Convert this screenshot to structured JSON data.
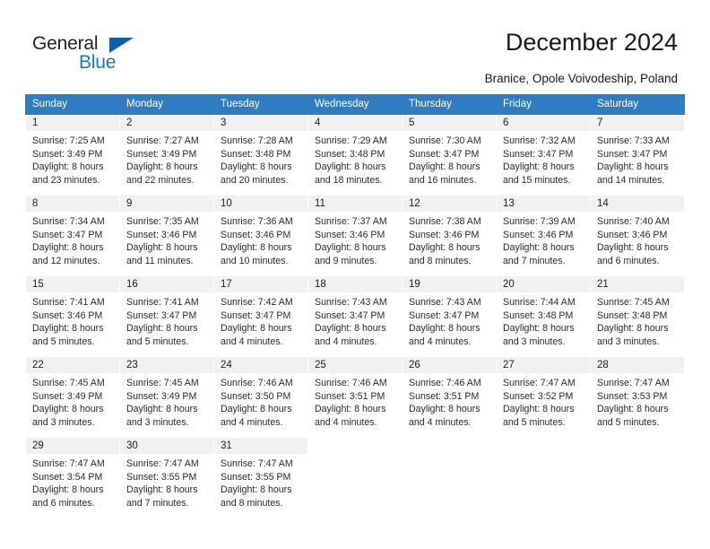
{
  "brand": {
    "name_part1": "General",
    "name_part2": "Blue",
    "triangle_icon": "blue-triangle-icon",
    "color_dark": "#222222",
    "color_blue": "#1f7ac4",
    "color_triangle": "#1060a8"
  },
  "header": {
    "title": "December 2024",
    "subtitle": "Branice, Opole Voivodeship, Poland"
  },
  "calendar": {
    "accent_color": "#2f7cc0",
    "daynum_bg": "#f1f1f1",
    "weekday_headers": [
      "Sunday",
      "Monday",
      "Tuesday",
      "Wednesday",
      "Thursday",
      "Friday",
      "Saturday"
    ],
    "weeks": [
      [
        {
          "day": "1",
          "sunrise": "Sunrise: 7:25 AM",
          "sunset": "Sunset: 3:49 PM",
          "daylight1": "Daylight: 8 hours",
          "daylight2": "and 23 minutes."
        },
        {
          "day": "2",
          "sunrise": "Sunrise: 7:27 AM",
          "sunset": "Sunset: 3:49 PM",
          "daylight1": "Daylight: 8 hours",
          "daylight2": "and 22 minutes."
        },
        {
          "day": "3",
          "sunrise": "Sunrise: 7:28 AM",
          "sunset": "Sunset: 3:48 PM",
          "daylight1": "Daylight: 8 hours",
          "daylight2": "and 20 minutes."
        },
        {
          "day": "4",
          "sunrise": "Sunrise: 7:29 AM",
          "sunset": "Sunset: 3:48 PM",
          "daylight1": "Daylight: 8 hours",
          "daylight2": "and 18 minutes."
        },
        {
          "day": "5",
          "sunrise": "Sunrise: 7:30 AM",
          "sunset": "Sunset: 3:47 PM",
          "daylight1": "Daylight: 8 hours",
          "daylight2": "and 16 minutes."
        },
        {
          "day": "6",
          "sunrise": "Sunrise: 7:32 AM",
          "sunset": "Sunset: 3:47 PM",
          "daylight1": "Daylight: 8 hours",
          "daylight2": "and 15 minutes."
        },
        {
          "day": "7",
          "sunrise": "Sunrise: 7:33 AM",
          "sunset": "Sunset: 3:47 PM",
          "daylight1": "Daylight: 8 hours",
          "daylight2": "and 14 minutes."
        }
      ],
      [
        {
          "day": "8",
          "sunrise": "Sunrise: 7:34 AM",
          "sunset": "Sunset: 3:47 PM",
          "daylight1": "Daylight: 8 hours",
          "daylight2": "and 12 minutes."
        },
        {
          "day": "9",
          "sunrise": "Sunrise: 7:35 AM",
          "sunset": "Sunset: 3:46 PM",
          "daylight1": "Daylight: 8 hours",
          "daylight2": "and 11 minutes."
        },
        {
          "day": "10",
          "sunrise": "Sunrise: 7:36 AM",
          "sunset": "Sunset: 3:46 PM",
          "daylight1": "Daylight: 8 hours",
          "daylight2": "and 10 minutes."
        },
        {
          "day": "11",
          "sunrise": "Sunrise: 7:37 AM",
          "sunset": "Sunset: 3:46 PM",
          "daylight1": "Daylight: 8 hours",
          "daylight2": "and 9 minutes."
        },
        {
          "day": "12",
          "sunrise": "Sunrise: 7:38 AM",
          "sunset": "Sunset: 3:46 PM",
          "daylight1": "Daylight: 8 hours",
          "daylight2": "and 8 minutes."
        },
        {
          "day": "13",
          "sunrise": "Sunrise: 7:39 AM",
          "sunset": "Sunset: 3:46 PM",
          "daylight1": "Daylight: 8 hours",
          "daylight2": "and 7 minutes."
        },
        {
          "day": "14",
          "sunrise": "Sunrise: 7:40 AM",
          "sunset": "Sunset: 3:46 PM",
          "daylight1": "Daylight: 8 hours",
          "daylight2": "and 6 minutes."
        }
      ],
      [
        {
          "day": "15",
          "sunrise": "Sunrise: 7:41 AM",
          "sunset": "Sunset: 3:46 PM",
          "daylight1": "Daylight: 8 hours",
          "daylight2": "and 5 minutes."
        },
        {
          "day": "16",
          "sunrise": "Sunrise: 7:41 AM",
          "sunset": "Sunset: 3:47 PM",
          "daylight1": "Daylight: 8 hours",
          "daylight2": "and 5 minutes."
        },
        {
          "day": "17",
          "sunrise": "Sunrise: 7:42 AM",
          "sunset": "Sunset: 3:47 PM",
          "daylight1": "Daylight: 8 hours",
          "daylight2": "and 4 minutes."
        },
        {
          "day": "18",
          "sunrise": "Sunrise: 7:43 AM",
          "sunset": "Sunset: 3:47 PM",
          "daylight1": "Daylight: 8 hours",
          "daylight2": "and 4 minutes."
        },
        {
          "day": "19",
          "sunrise": "Sunrise: 7:43 AM",
          "sunset": "Sunset: 3:47 PM",
          "daylight1": "Daylight: 8 hours",
          "daylight2": "and 4 minutes."
        },
        {
          "day": "20",
          "sunrise": "Sunrise: 7:44 AM",
          "sunset": "Sunset: 3:48 PM",
          "daylight1": "Daylight: 8 hours",
          "daylight2": "and 3 minutes."
        },
        {
          "day": "21",
          "sunrise": "Sunrise: 7:45 AM",
          "sunset": "Sunset: 3:48 PM",
          "daylight1": "Daylight: 8 hours",
          "daylight2": "and 3 minutes."
        }
      ],
      [
        {
          "day": "22",
          "sunrise": "Sunrise: 7:45 AM",
          "sunset": "Sunset: 3:49 PM",
          "daylight1": "Daylight: 8 hours",
          "daylight2": "and 3 minutes."
        },
        {
          "day": "23",
          "sunrise": "Sunrise: 7:45 AM",
          "sunset": "Sunset: 3:49 PM",
          "daylight1": "Daylight: 8 hours",
          "daylight2": "and 3 minutes."
        },
        {
          "day": "24",
          "sunrise": "Sunrise: 7:46 AM",
          "sunset": "Sunset: 3:50 PM",
          "daylight1": "Daylight: 8 hours",
          "daylight2": "and 4 minutes."
        },
        {
          "day": "25",
          "sunrise": "Sunrise: 7:46 AM",
          "sunset": "Sunset: 3:51 PM",
          "daylight1": "Daylight: 8 hours",
          "daylight2": "and 4 minutes."
        },
        {
          "day": "26",
          "sunrise": "Sunrise: 7:46 AM",
          "sunset": "Sunset: 3:51 PM",
          "daylight1": "Daylight: 8 hours",
          "daylight2": "and 4 minutes."
        },
        {
          "day": "27",
          "sunrise": "Sunrise: 7:47 AM",
          "sunset": "Sunset: 3:52 PM",
          "daylight1": "Daylight: 8 hours",
          "daylight2": "and 5 minutes."
        },
        {
          "day": "28",
          "sunrise": "Sunrise: 7:47 AM",
          "sunset": "Sunset: 3:53 PM",
          "daylight1": "Daylight: 8 hours",
          "daylight2": "and 5 minutes."
        }
      ],
      [
        {
          "day": "29",
          "sunrise": "Sunrise: 7:47 AM",
          "sunset": "Sunset: 3:54 PM",
          "daylight1": "Daylight: 8 hours",
          "daylight2": "and 6 minutes."
        },
        {
          "day": "30",
          "sunrise": "Sunrise: 7:47 AM",
          "sunset": "Sunset: 3:55 PM",
          "daylight1": "Daylight: 8 hours",
          "daylight2": "and 7 minutes."
        },
        {
          "day": "31",
          "sunrise": "Sunrise: 7:47 AM",
          "sunset": "Sunset: 3:55 PM",
          "daylight1": "Daylight: 8 hours",
          "daylight2": "and 8 minutes."
        },
        {
          "day": "",
          "sunrise": "",
          "sunset": "",
          "daylight1": "",
          "daylight2": ""
        },
        {
          "day": "",
          "sunrise": "",
          "sunset": "",
          "daylight1": "",
          "daylight2": ""
        },
        {
          "day": "",
          "sunrise": "",
          "sunset": "",
          "daylight1": "",
          "daylight2": ""
        },
        {
          "day": "",
          "sunrise": "",
          "sunset": "",
          "daylight1": "",
          "daylight2": ""
        }
      ]
    ]
  }
}
